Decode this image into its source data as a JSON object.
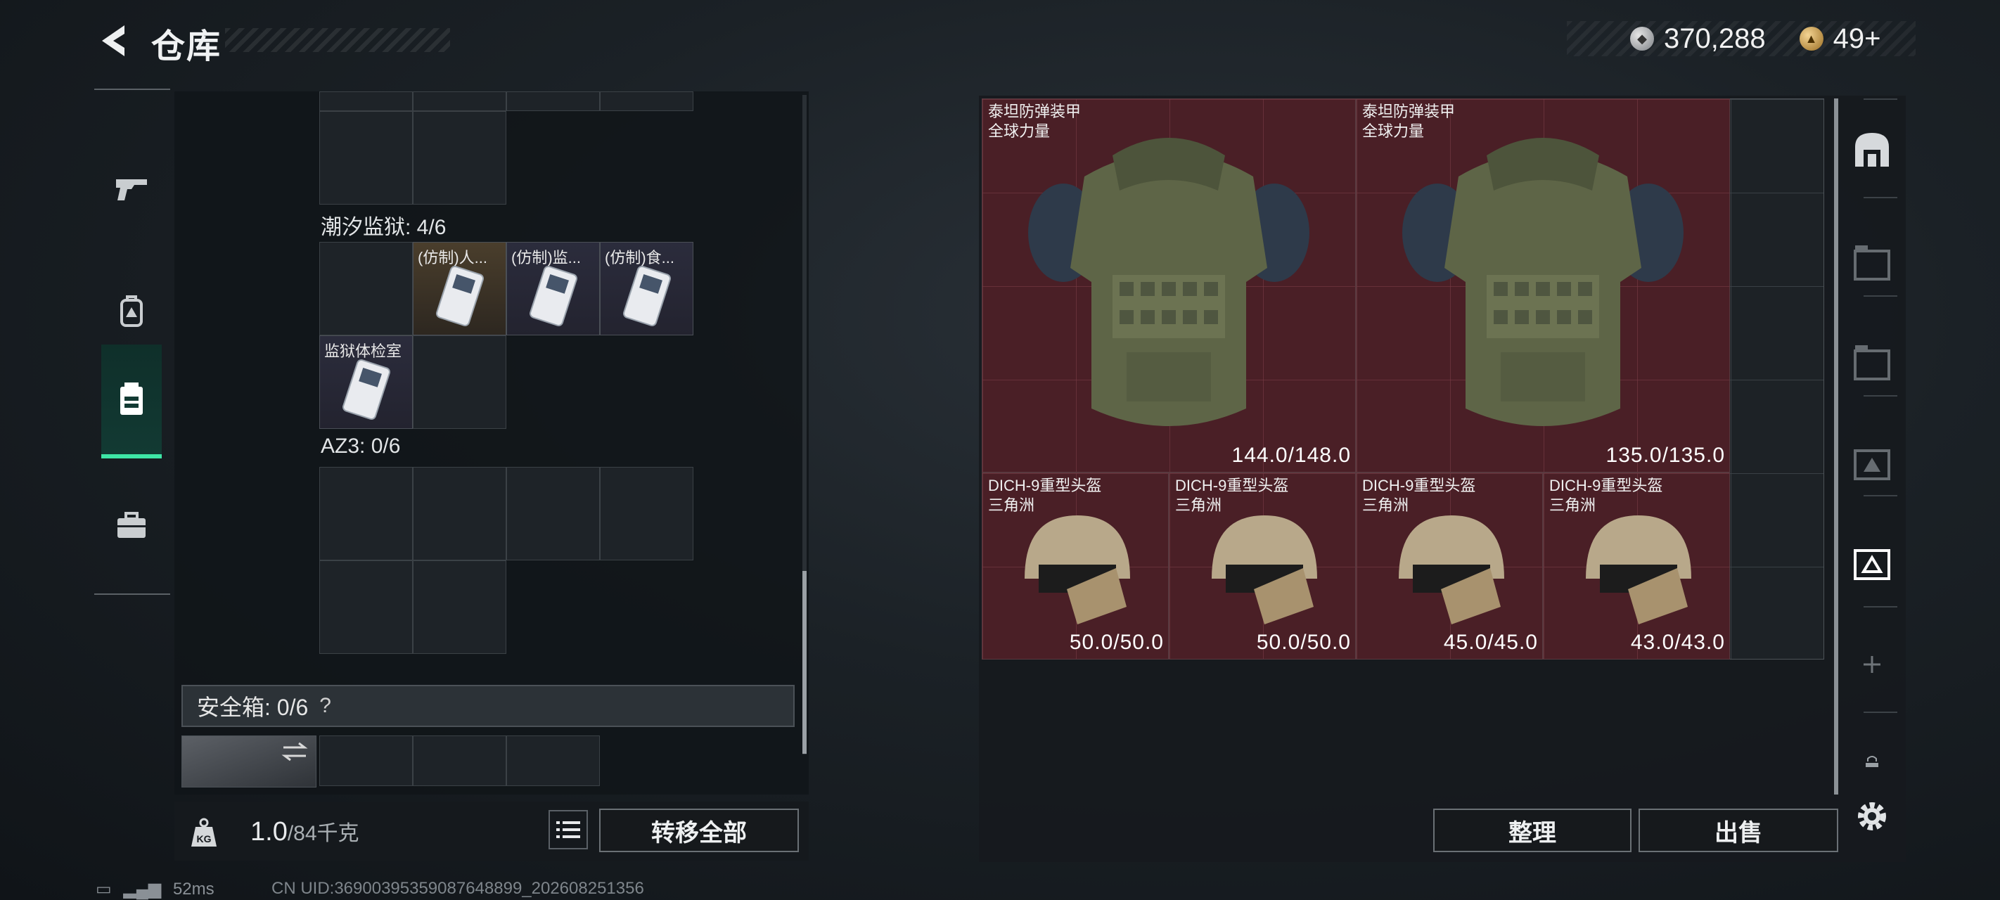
{
  "header": {
    "title": "仓库"
  },
  "currency": {
    "silver": "370,288",
    "gold": "49+"
  },
  "left_tabs": [
    {
      "name": "weapon-tab-icon"
    },
    {
      "name": "backpack-tab-icon"
    },
    {
      "name": "chest-rig-tab-icon",
      "active": true
    },
    {
      "name": "case-tab-icon"
    }
  ],
  "containers": {
    "section1_label": "潮汐监狱: 4/6",
    "section1_items": [
      {
        "label": "(仿制)人..."
      },
      {
        "label": "(仿制)监..."
      },
      {
        "label": "(仿制)食..."
      },
      {
        "label": "监狱体检室"
      }
    ],
    "section2_label": "AZ3: 0/6"
  },
  "safe_box": {
    "label": "安全箱: 0/6",
    "help": "?"
  },
  "weight": {
    "current": "1.0",
    "max": "/84千克"
  },
  "buttons": {
    "transfer_all": "转移全部",
    "sort": "整理",
    "sell": "出售"
  },
  "stash": {
    "armors": [
      {
        "name": "泰坦防弹装甲",
        "sub": "全球力量",
        "durability": "144.0/148.0"
      },
      {
        "name": "泰坦防弹装甲",
        "sub": "全球力量",
        "durability": "135.0/135.0"
      }
    ],
    "helmets": [
      {
        "name": "DICH-9重型头盔",
        "sub": "三角洲",
        "durability": "50.0/50.0"
      },
      {
        "name": "DICH-9重型头盔",
        "sub": "三角洲",
        "durability": "50.0/50.0"
      },
      {
        "name": "DICH-9重型头盔",
        "sub": "三角洲",
        "durability": "45.0/45.0"
      },
      {
        "name": "DICH-9重型头盔",
        "sub": "三角洲",
        "durability": "43.0/43.0"
      }
    ]
  },
  "footer": {
    "ping": "52ms",
    "uid": "CN UID:36900395359087648899_202608251356"
  }
}
